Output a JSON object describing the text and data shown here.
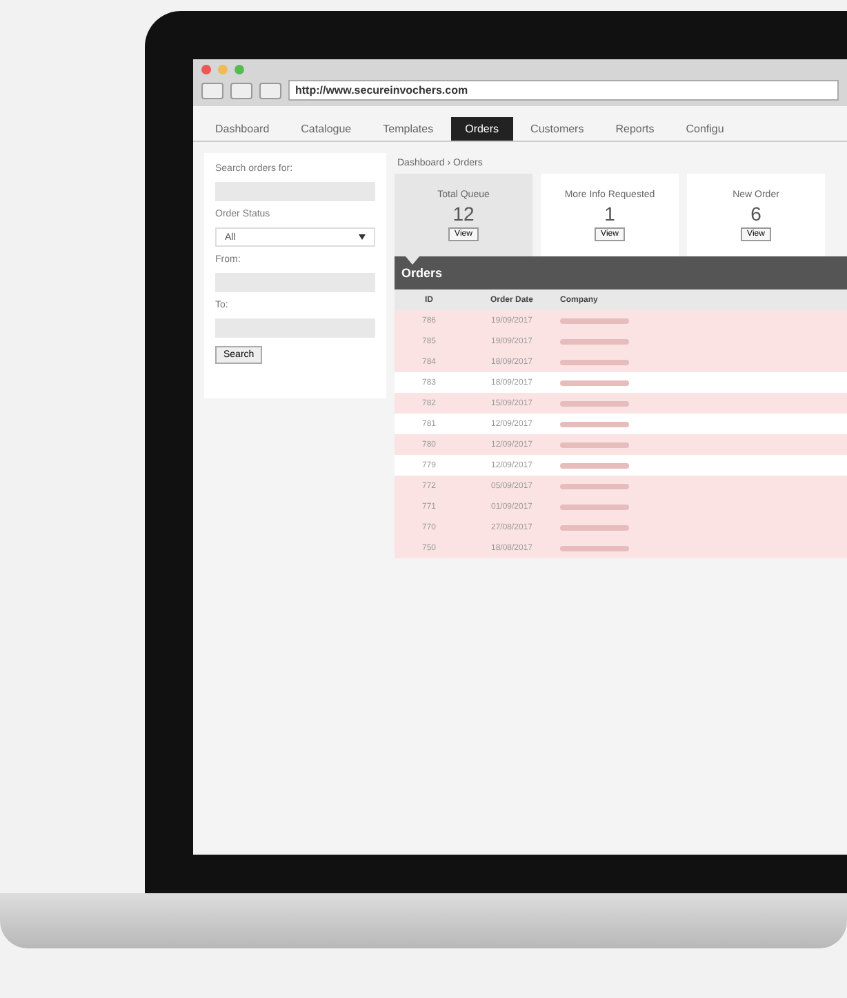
{
  "browser": {
    "url": "http://www.secureinvochers.com"
  },
  "tabs": [
    {
      "label": "Dashboard",
      "selected": false
    },
    {
      "label": "Catalogue",
      "selected": false
    },
    {
      "label": "Templates",
      "selected": false
    },
    {
      "label": "Orders",
      "selected": true
    },
    {
      "label": "Customers",
      "selected": false
    },
    {
      "label": "Reports",
      "selected": false
    },
    {
      "label": "Configu",
      "selected": false
    }
  ],
  "sidebar": {
    "search_label": "Search orders for:",
    "status_label": "Order Status",
    "status_value": "All",
    "from_label": "From:",
    "to_label": "To:",
    "button": "Search"
  },
  "breadcrumb": "Dashboard › Orders",
  "cards": [
    {
      "title": "Total Queue",
      "count": "12",
      "button": "View",
      "selected": true
    },
    {
      "title": "More Info Requested",
      "count": "1",
      "button": "View",
      "selected": false
    },
    {
      "title": "New Order",
      "count": "6",
      "button": "View",
      "selected": false
    }
  ],
  "orders": {
    "title": "Orders",
    "columns": [
      "ID",
      "Order Date",
      "Company"
    ],
    "rows": [
      {
        "id": "786",
        "date": "19/09/2017",
        "highlighted": true
      },
      {
        "id": "785",
        "date": "19/09/2017",
        "highlighted": true
      },
      {
        "id": "784",
        "date": "18/09/2017",
        "highlighted": true
      },
      {
        "id": "783",
        "date": "18/09/2017",
        "highlighted": false
      },
      {
        "id": "782",
        "date": "15/09/2017",
        "highlighted": true
      },
      {
        "id": "781",
        "date": "12/09/2017",
        "highlighted": false
      },
      {
        "id": "780",
        "date": "12/09/2017",
        "highlighted": true
      },
      {
        "id": "779",
        "date": "12/09/2017",
        "highlighted": false
      },
      {
        "id": "772",
        "date": "05/09/2017",
        "highlighted": true
      },
      {
        "id": "771",
        "date": "01/09/2017",
        "highlighted": true
      },
      {
        "id": "770",
        "date": "27/08/2017",
        "highlighted": true
      },
      {
        "id": "750",
        "date": "18/08/2017",
        "highlighted": true
      }
    ]
  }
}
